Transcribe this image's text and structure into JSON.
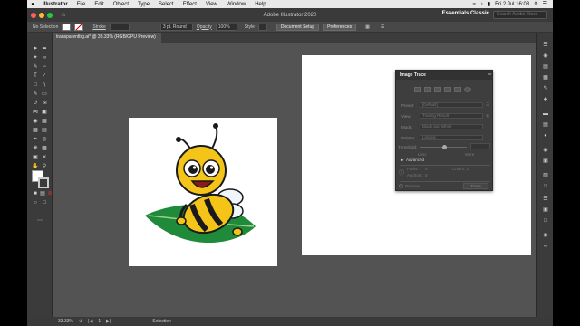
{
  "menubar": {
    "app": "Illustrator",
    "items": [
      "File",
      "Edit",
      "Object",
      "Type",
      "Select",
      "Effect",
      "View",
      "Window",
      "Help"
    ],
    "clock": "Fri 2 Jul  16:03"
  },
  "titlebar": {
    "title": "Adobe Illustrator 2020",
    "workspace": "Essentials Classic",
    "search_placeholder": "Search Adobe Stock"
  },
  "controlbar": {
    "selection": "No Selection",
    "stroke_label": "Stroke",
    "brush": "3 pt. Round",
    "opacity_label": "Opacity",
    "opacity_value": "100%",
    "style_label": "Style",
    "doc_setup": "Document Setup",
    "preferences": "Preferences"
  },
  "document": {
    "tab": "transparentbg.ai* @ 33.33% (RGB/GPU Preview)"
  },
  "trace": {
    "title": "Image Trace",
    "preset_label": "Preset:",
    "preset_value": "[Default]",
    "view_label": "View:",
    "view_value": "Tracing Result",
    "mode_label": "Mode:",
    "mode_value": "Black and White",
    "palette_label": "Palette:",
    "palette_value": "Limited",
    "threshold_label": "Threshold:",
    "less": "Less",
    "more": "More",
    "advanced": "Advanced",
    "paths_label": "Paths:",
    "paths_value": "0",
    "colors_label": "Colors:",
    "colors_value": "0",
    "anchors_label": "Anchors:",
    "anchors_value": "0",
    "preview": "Preview",
    "trace_btn": "Trace"
  },
  "status": {
    "zoom": "33.33%",
    "page": "1",
    "tool": "Selection"
  },
  "colors": {
    "canvas": "#535353",
    "leaf": "#1f8a3a",
    "bee_yellow": "#f4c518",
    "bee_black": "#1a1a1a"
  }
}
